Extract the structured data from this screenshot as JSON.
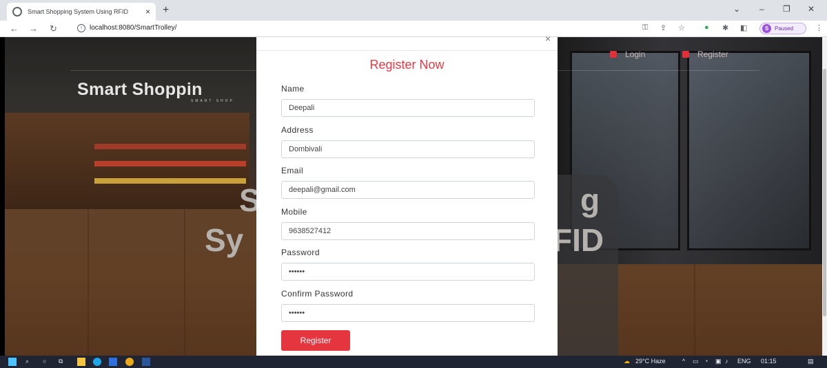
{
  "browser": {
    "tab_title": "Smart Shopping System Using RFID",
    "tab_close": "×",
    "new_tab": "+",
    "url": "localhost:8080/SmartTrolley/",
    "profile_initial": "S",
    "profile_status": "Paused"
  },
  "site": {
    "brand": "Smart Shoppin",
    "brand_sub": "SMART SHOP",
    "nav_login": "Login",
    "nav_register": "Register",
    "hero_l1": "S",
    "hero_l2": "Sy",
    "hero_r1": "g",
    "hero_r2": "FID"
  },
  "modal": {
    "close": "×",
    "title": "Register Now",
    "fields": [
      {
        "label": "Name",
        "value": "Deepali"
      },
      {
        "label": "Address",
        "value": "Dombivali"
      },
      {
        "label": "Email",
        "value": "deepali@gmail.com"
      },
      {
        "label": "Mobile",
        "value": "9638527412"
      },
      {
        "label": "Password",
        "value": "••••••"
      },
      {
        "label": "Confirm Password",
        "value": "••••••"
      }
    ],
    "submit": "Register"
  },
  "taskbar": {
    "weather": "29°C Haze",
    "language": "ENG",
    "time": "01:15"
  },
  "colors": {
    "accent": "#e5353f",
    "title": "#e53a45",
    "taskbar": "#1f2533"
  }
}
